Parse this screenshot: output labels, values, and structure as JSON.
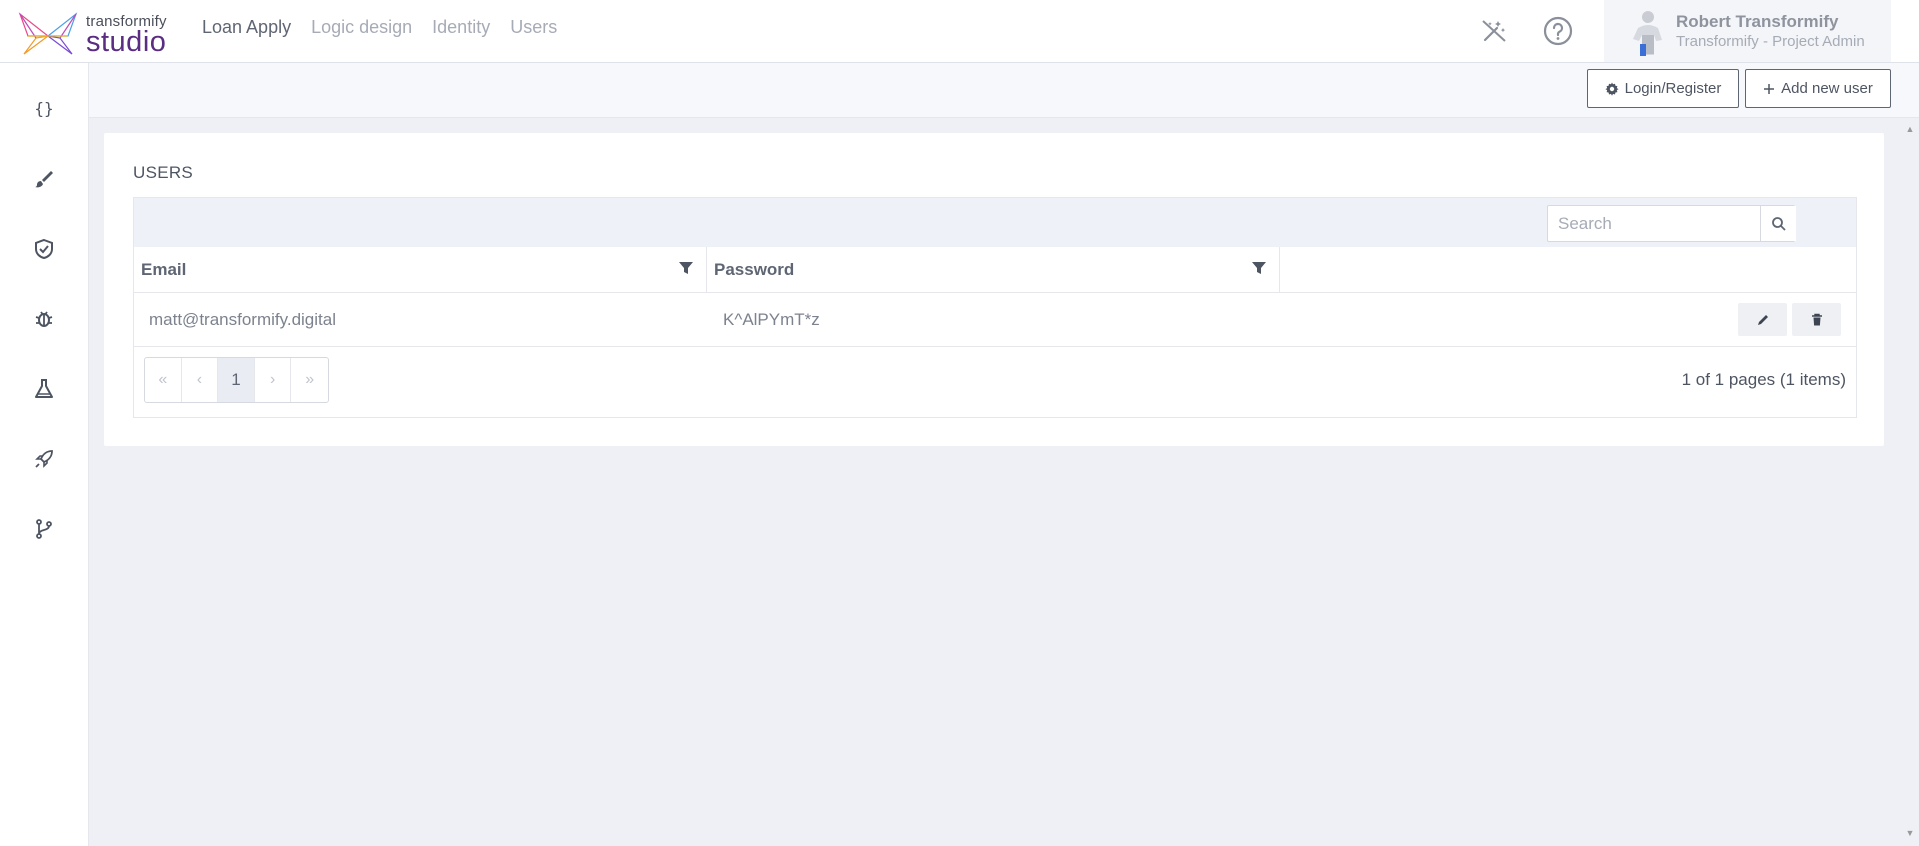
{
  "header": {
    "brand_top": "transformify",
    "brand_bottom": "studio",
    "nav": [
      "Loan Apply",
      "Logic design",
      "Identity",
      "Users"
    ],
    "user": {
      "name": "Robert Transformify",
      "role": "Transformify - Project Admin"
    }
  },
  "sidebar": {
    "icons": [
      "code-braces-icon",
      "brush-icon",
      "shield-check-icon",
      "bug-icon",
      "flask-icon",
      "rocket-icon",
      "branch-icon"
    ]
  },
  "toolbar": {
    "login_label": "Login/Register",
    "add_user_label": "Add new user"
  },
  "users": {
    "title": "USERS",
    "search_placeholder": "Search",
    "columns": [
      "Email",
      "Password"
    ],
    "rows": [
      {
        "email": "matt@transformify.digital",
        "password": "K^AlPYmT*z"
      }
    ],
    "pager": {
      "first": "«",
      "prev": "‹",
      "current": "1",
      "next": "›",
      "last": "»"
    },
    "page_info": "1 of 1 pages (1 items)"
  },
  "colors": {
    "brand_purple": "#5a2d82",
    "background": "#eef0f6",
    "text": "#5f6673"
  }
}
